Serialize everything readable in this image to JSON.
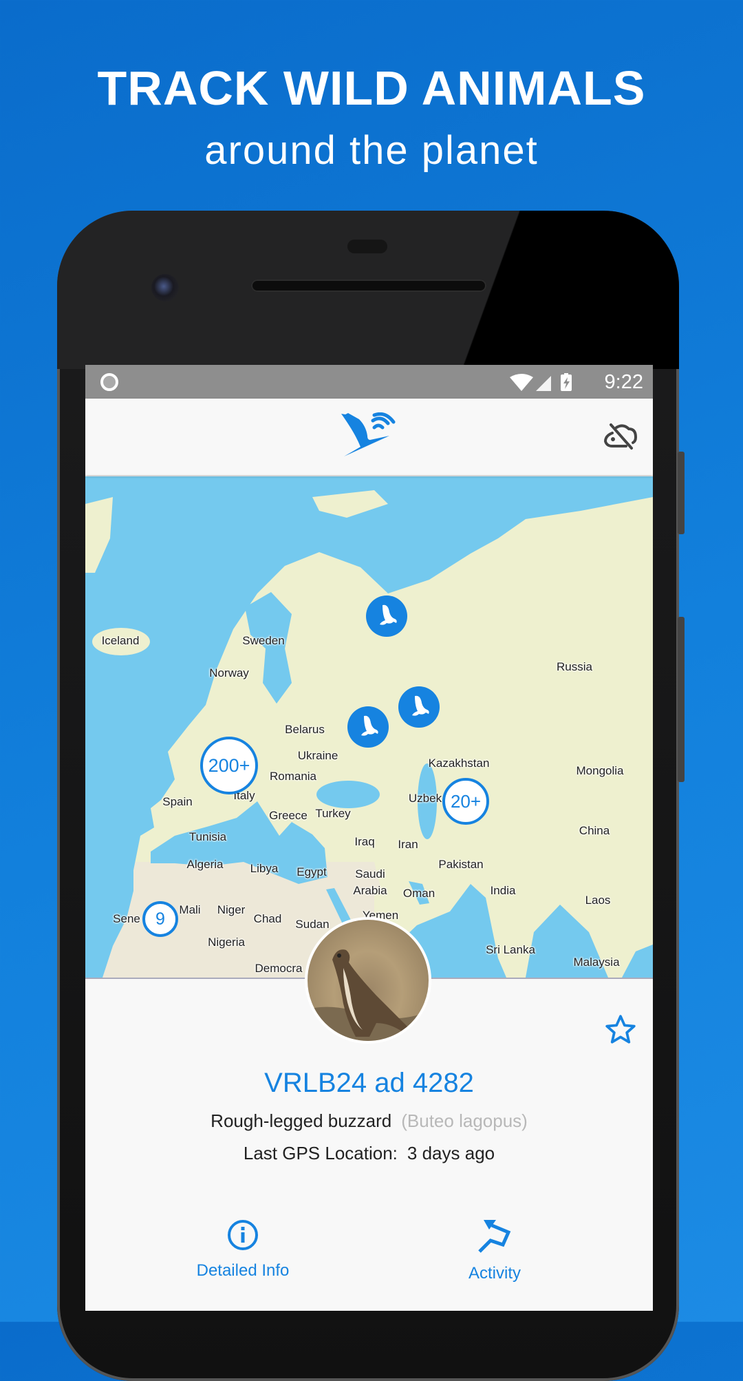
{
  "promo": {
    "title": "TRACK WILD ANIMALS",
    "subtitle": "around the planet"
  },
  "colors": {
    "background": "#0a6ccb",
    "accent": "#1683e0",
    "ocean": "#74c9ee",
    "land": "#eef0cf"
  },
  "status_bar": {
    "time": "9:22",
    "icons": [
      "notification-circle-icon",
      "wifi-icon",
      "cell-signal-icon",
      "battery-charging-icon"
    ]
  },
  "app_bar": {
    "logo": "bird-signal-logo",
    "sync_icon": "cloud-off-icon"
  },
  "map": {
    "labels": [
      "Iceland",
      "Sweden",
      "Norway",
      "Russia",
      "Belarus",
      "Ukraine",
      "Kazakhstan",
      "Mongolia",
      "Romania",
      "Spain",
      "Italy",
      "Greece",
      "Turkey",
      "Uzbek",
      "China",
      "Tunisia",
      "Iraq",
      "Iran",
      "Algeria",
      "Libya",
      "Egypt",
      "Saudi",
      "Arabia",
      "Pakistan",
      "Oman",
      "India",
      "Laos",
      "Mali",
      "Niger",
      "Sene",
      "Chad",
      "Sudan",
      "Yemen",
      "Nigeria",
      "Sri Lanka",
      "Malaysia",
      "Democra"
    ],
    "clusters": [
      {
        "count": "200+"
      },
      {
        "count": "20+"
      },
      {
        "count": "9"
      }
    ],
    "animal_markers": 3
  },
  "animal": {
    "name": "VRLB24 ad 4282",
    "common_name": "Rough-legged buzzard",
    "latin_name": "(Buteo lagopus)",
    "last_gps_label": "Last GPS Location:",
    "last_gps_value": "3 days ago",
    "favorite": false
  },
  "actions": {
    "detailed_info": "Detailed Info",
    "activity": "Activity"
  }
}
